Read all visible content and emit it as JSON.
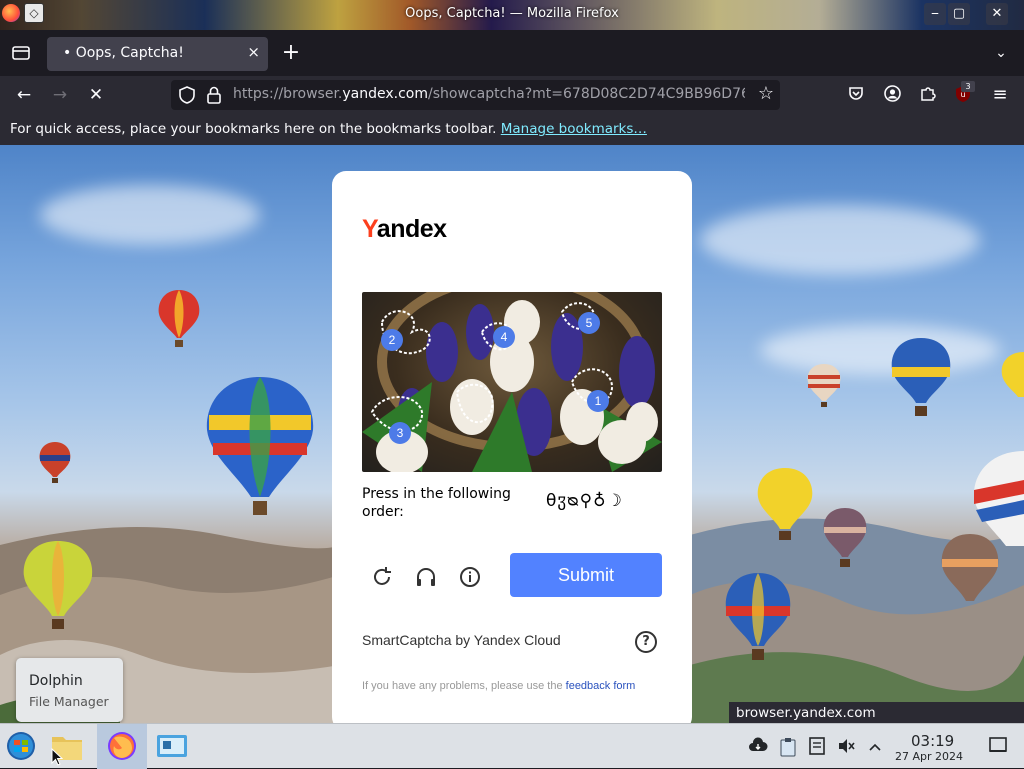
{
  "window": {
    "title": "Oops, Captcha! — Mozilla Firefox",
    "controls": {
      "minimize": "⎯",
      "maximize": "▢",
      "close": "✕"
    }
  },
  "tabs": [
    {
      "label": "• Oops, Captcha!",
      "active": true,
      "close_icon": "×"
    }
  ],
  "tabstrip": {
    "new_tab": "+",
    "list_all_tabs": "⌄"
  },
  "navbar": {
    "back": "←",
    "forward": "→",
    "stop": "✕",
    "url_prefix": "https://browser.",
    "url_host": "yandex.com",
    "url_path": "/showcaptcha?mt=678D08C2D74C9BB96D76",
    "bookmark_star": "☆",
    "extension_badge": "3",
    "menu": "≡"
  },
  "bookmarks_toolbar": {
    "message": "For quick access, place your bookmarks here on the bookmarks toolbar.",
    "link": "Manage bookmarks…"
  },
  "captcha": {
    "logo_first": "Y",
    "logo_rest": "andex",
    "markers": [
      "1",
      "2",
      "3",
      "4",
      "5"
    ],
    "order_label": "Press in the following order:",
    "order_icons": "θჳᴓ⚲♁☽",
    "submit_label": "Submit",
    "footer_brand": "SmartCaptcha by Yandex Cloud",
    "help_label": "?",
    "problem_text": "If you have any problems, please use the",
    "problem_link": "feedback form"
  },
  "tooltip": {
    "title": "Dolphin",
    "subtitle": "File Manager"
  },
  "status_url": "browser.yandex.com",
  "taskbar": {
    "time": "03:19",
    "date": "27 Apr 2024"
  },
  "colors": {
    "accent": "#5282ff",
    "yandex_red": "#fc3f1d",
    "link": "#80ebff",
    "marker": "#4d7be8"
  }
}
